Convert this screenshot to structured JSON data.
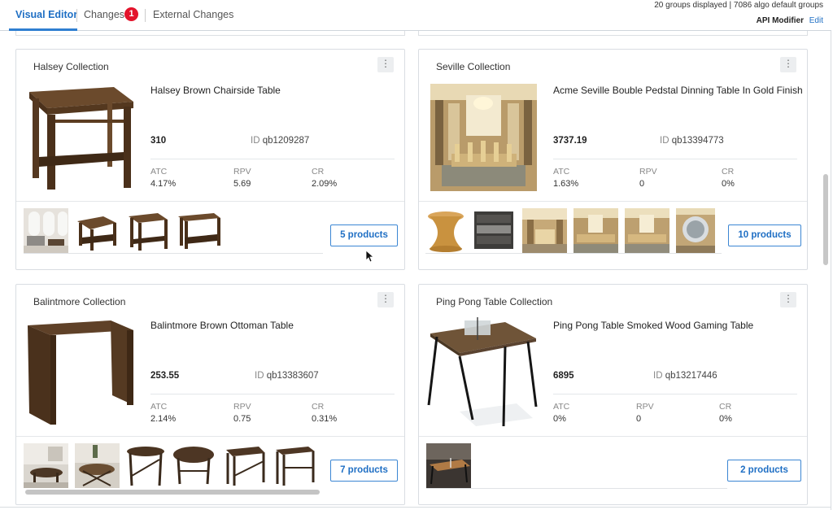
{
  "header": {
    "tabs": [
      {
        "label": "Visual Editor",
        "active": true
      },
      {
        "label": "Changes",
        "badge": "1"
      },
      {
        "label": "External Changes"
      }
    ],
    "groups_info": "20 groups displayed | 7086 algo default groups",
    "api_modifier_label": "API Modifier",
    "edit_label": "Edit"
  },
  "metric_labels": {
    "atc": "ATC",
    "rpv": "RPV",
    "cr": "CR",
    "id": "ID"
  },
  "cards": [
    {
      "collection": "Halsey Collection",
      "product": "Halsey Brown Chairside Table",
      "price": "310",
      "id": "qb1209287",
      "atc": "4.17%",
      "rpv": "5.69",
      "cr": "2.09%",
      "button": "5 products"
    },
    {
      "collection": "Seville Collection",
      "product": "Acme Seville Bouble Pedstal Dinning Table In Gold Finish",
      "price": "3737.19",
      "id": "qb13394773",
      "atc": "1.63%",
      "rpv": "0",
      "cr": "0%",
      "button": "10 products"
    },
    {
      "collection": "Balintmore Collection",
      "product": "Balintmore Brown Ottoman Table",
      "price": "253.55",
      "id": "qb13383607",
      "atc": "2.14%",
      "rpv": "0.75",
      "cr": "0.31%",
      "button": "7 products"
    },
    {
      "collection": "Ping Pong Table Collection",
      "product": "Ping Pong Table Smoked Wood Gaming Table",
      "price": "6895",
      "id": "qb13217446",
      "atc": "0%",
      "rpv": "0",
      "cr": "0%",
      "button": "2 products"
    }
  ],
  "colors": {
    "accent": "#1f6fc4",
    "badge": "#e3132b"
  }
}
